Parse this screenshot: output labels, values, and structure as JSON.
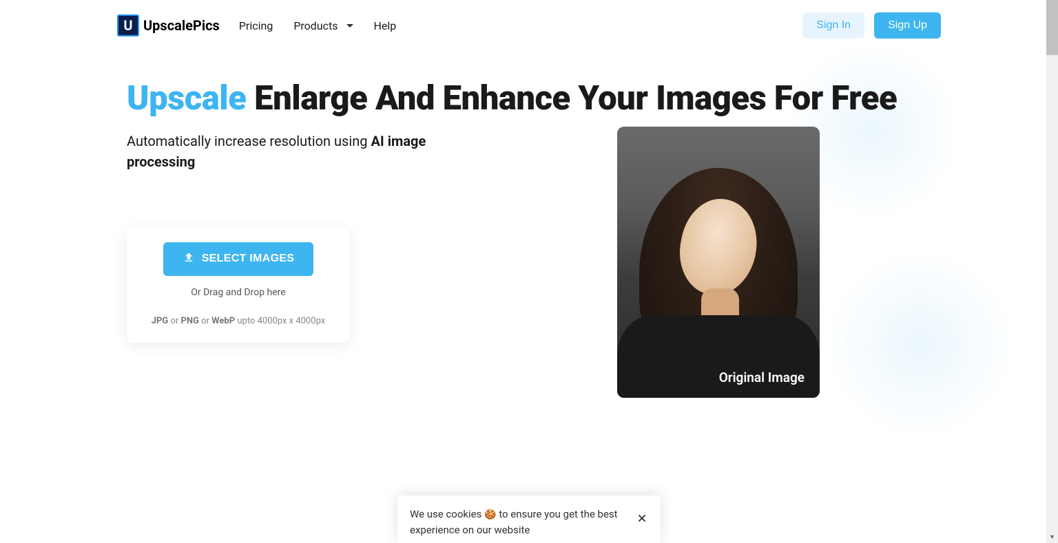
{
  "logo": {
    "icon_letter": "U",
    "text": "UpscalePics"
  },
  "nav": {
    "pricing": "Pricing",
    "products": "Products",
    "help": "Help"
  },
  "auth": {
    "signin": "Sign In",
    "signup": "Sign Up"
  },
  "hero": {
    "title_accent": "Upscale",
    "title_rest": " Enlarge And Enhance Your Images For Free",
    "subtitle_prefix": "Automatically increase resolution using ",
    "subtitle_bold": "AI image processing"
  },
  "upload": {
    "button": "SELECT IMAGES",
    "hint": "Or Drag and Drop here",
    "fmt_jpg": "JPG",
    "fmt_or1": " or ",
    "fmt_png": "PNG",
    "fmt_or2": " or ",
    "fmt_webp": "WebP",
    "fmt_size": " upto 4000px x 4000px"
  },
  "sample": {
    "label": "Original Image"
  },
  "cookie": {
    "text_before": "We use cookies ",
    "emoji": "🍪",
    "text_after": " to ensure you get the best experience on our website"
  }
}
